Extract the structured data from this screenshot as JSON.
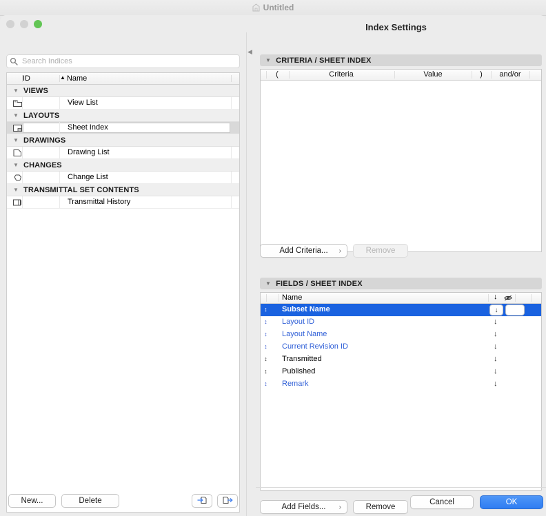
{
  "document": {
    "title": "Untitled",
    "icon": "document-icon"
  },
  "window": {
    "panel_title": "Index Settings",
    "traffic_lights": [
      "close",
      "minimize",
      "zoom"
    ]
  },
  "sidebar": {
    "search": {
      "placeholder": "Search Indices",
      "value": "",
      "icon": "search-icon"
    },
    "columns": {
      "id": "ID",
      "name": "Name",
      "sort_indicator": "▲"
    },
    "groups": [
      {
        "label": "VIEWS",
        "items": [
          {
            "id": "",
            "name": "View List",
            "icon": "view-list-icon",
            "selected": false
          }
        ]
      },
      {
        "label": "LAYOUTS",
        "items": [
          {
            "id": "",
            "name": "Sheet Index",
            "icon": "sheet-index-icon",
            "selected": true
          }
        ]
      },
      {
        "label": "DRAWINGS",
        "items": [
          {
            "id": "",
            "name": "Drawing List",
            "icon": "drawing-list-icon",
            "selected": false
          }
        ]
      },
      {
        "label": "CHANGES",
        "items": [
          {
            "id": "",
            "name": "Change List",
            "icon": "change-list-icon",
            "selected": false
          }
        ]
      },
      {
        "label": "TRANSMITTAL SET CONTENTS",
        "items": [
          {
            "id": "",
            "name": "Transmittal History",
            "icon": "transmittal-history-icon",
            "selected": false
          }
        ]
      }
    ],
    "buttons": {
      "new": "New...",
      "delete": "Delete",
      "import_icon": "import-document-icon",
      "export_icon": "export-document-icon"
    }
  },
  "criteria": {
    "section_title": "CRITERIA /  SHEET INDEX",
    "columns": [
      "(",
      "Criteria",
      "Value",
      ")",
      "and/or"
    ],
    "rows": [],
    "buttons": {
      "add": "Add Criteria...",
      "add_chevron": "›",
      "remove": "Remove",
      "remove_disabled": true
    }
  },
  "fields": {
    "section_title": "FIELDS /  SHEET INDEX",
    "columns": {
      "name": "Name",
      "sort_icon": "↓",
      "hidden_icon": "hidden-eye-icon"
    },
    "rows": [
      {
        "name": "Subset Name",
        "selected": true,
        "blue": true,
        "sort": "↓",
        "has_controls": true
      },
      {
        "name": "Layout ID",
        "selected": false,
        "blue": true,
        "sort": "↓",
        "has_controls": false
      },
      {
        "name": "Layout Name",
        "selected": false,
        "blue": true,
        "sort": "↓",
        "has_controls": false
      },
      {
        "name": "Current Revision ID",
        "selected": false,
        "blue": true,
        "sort": "↓",
        "has_controls": false
      },
      {
        "name": "Transmitted",
        "selected": false,
        "blue": false,
        "sort": "↓",
        "has_controls": false
      },
      {
        "name": "Published",
        "selected": false,
        "blue": false,
        "sort": "↓",
        "has_controls": false
      },
      {
        "name": "Remark",
        "selected": false,
        "blue": true,
        "sort": "↓",
        "has_controls": false
      }
    ],
    "buttons": {
      "add": "Add Fields...",
      "add_chevron": "›",
      "remove": "Remove"
    }
  },
  "dialog_buttons": {
    "cancel": "Cancel",
    "ok": "OK"
  },
  "colors": {
    "selection_blue": "#1a62e0",
    "link_blue": "#2f5fd7",
    "primary_button": "#2f7df2",
    "window_bg": "#ececec",
    "section_header_bg": "#d6d6d6"
  }
}
